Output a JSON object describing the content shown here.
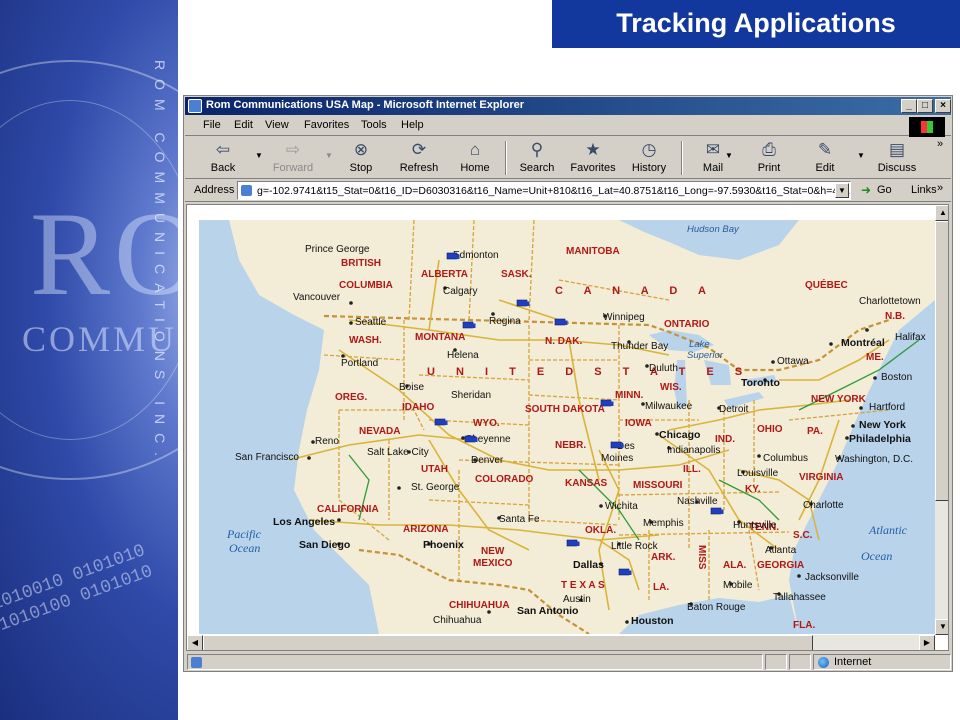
{
  "slide": {
    "title": "Tracking Applications",
    "watermark_big": "RO",
    "watermark_small": "COMMU",
    "vertical_text": "ROM COMMUNICATIONS INC.",
    "binary_text": "1010010 0101010 1010100 0101010"
  },
  "browser": {
    "window_title": "Rom Communications USA Map - Microsoft Internet Explorer",
    "window_buttons": [
      "_",
      "□",
      "×"
    ],
    "menu": [
      "File",
      "Edit",
      "View",
      "Favorites",
      "Tools",
      "Help"
    ],
    "toolbar": {
      "back": "Back",
      "forward": "Forward",
      "stop": "Stop",
      "refresh": "Refresh",
      "home": "Home",
      "search": "Search",
      "favorites": "Favorites",
      "history": "History",
      "mail": "Mail",
      "print": "Print",
      "edit": "Edit",
      "discuss": "Discuss",
      "more": "»"
    },
    "address": {
      "label": "Address",
      "value": "g=-102.9741&t15_Stat=0&t16_ID=D6030316&t16_Name=Unit+810&t16_Lat=40.8751&t16_Long=-97.5930&t16_Stat=0&h=4416",
      "go": "Go",
      "links": "Links",
      "links_more": "»"
    },
    "status": {
      "zone": "Internet"
    }
  },
  "map": {
    "colors": {
      "land": "#f3ecd6",
      "canada_land": "#efe8d2",
      "water": "#b9d3ea",
      "state_border": "#d6a23c",
      "highway": "#d9b43a",
      "vehicle": "#1f3fbf"
    },
    "country_labels": {
      "canada": "C A N A D A",
      "usa": "U N I T E D   S T A T E S"
    },
    "ocean_labels": {
      "pacific_1": "Pacific",
      "pacific_2": "Ocean",
      "atlantic_1": "Atlantic",
      "atlantic_2": "Ocean"
    },
    "water_labels": {
      "hudson": "Hudson Bay",
      "superior_1": "Lake",
      "superior_2": "Superior"
    },
    "region_labels": {
      "british_columbia_1": "BRITISH",
      "british_columbia_2": "COLUMBIA",
      "alberta": "ALBERTA",
      "sask": "SASK.",
      "manitoba": "MANITOBA",
      "ontario": "ONTARIO",
      "quebec": "QUÉBEC",
      "nb": "N.B.",
      "me": "ME.",
      "wash": "WASH.",
      "montana": "MONTANA",
      "ndak": "N. DAK.",
      "minn": "MINN.",
      "oreg": "OREG.",
      "idaho": "IDAHO",
      "wyo": "WYO.",
      "sdak": "SOUTH DAKOTA",
      "wis": "WIS.",
      "mich": "MICH",
      "newyork_state": "NEW YORK",
      "nevada": "NEVADA",
      "utah": "UTAH",
      "colorado": "COLORADO",
      "nebr": "NEBR.",
      "iowa": "IOWA",
      "ill": "ILL.",
      "ind": "IND.",
      "ohio": "OHIO",
      "pa": "PA.",
      "california": "CALIFORNIA",
      "kansas": "KANSAS",
      "missouri": "MISSOURI",
      "ky": "KY.",
      "virginia": "VIRGINIA",
      "arizona": "ARIZONA",
      "newmexico_1": "NEW",
      "newmexico_2": "MEXICO",
      "okla": "OKLA.",
      "ark": "ARK.",
      "tenn": "TENN.",
      "sc": "S.C.",
      "texas": "T E X A S",
      "la": "LA.",
      "miss": "MISS",
      "ala": "ALA.",
      "georgia": "GEORGIA",
      "fla": "FLA.",
      "chihuahua": "CHIHUAHUA"
    },
    "city_labels": {
      "prince_george": "Prince George",
      "edmonton": "Edmonton",
      "calgary": "Calgary",
      "vancouver": "Vancouver",
      "seattle": "Seattle",
      "regina": "Regina",
      "winnipeg": "Winnipeg",
      "thunder_bay": "Thunder Bay",
      "charlottetown": "Charlottetown",
      "halifax": "Halifax",
      "montreal": "Montréal",
      "ottawa": "Ottawa",
      "toronto": "Toronto",
      "boston": "Boston",
      "hartford": "Hartford",
      "new_york": "New York",
      "philadelphia": "Philadelphia",
      "washington": "Washington, D.C.",
      "portland": "Portland",
      "helena": "Helena",
      "duluth": "Duluth",
      "milwaukee": "Milwaukee",
      "detroit": "Detroit",
      "boise": "Boise",
      "sheridan": "Sheridan",
      "chicago": "Chicago",
      "reno": "Reno",
      "cheyenne": "Cheyenne",
      "des_moines_1": "Des",
      "des_moines_2": "Moines",
      "indianapolis": "Indianapolis",
      "columbus": "Columbus",
      "san_francisco": "San Francisco",
      "salt_lake": "Salt Lake City",
      "denver": "Denver",
      "louisville": "Louisville",
      "st_george": "St. George",
      "wichita": "Wichita",
      "nashville": "Nashville",
      "charlotte": "Charlotte",
      "los_angeles": "Los Angeles",
      "santa_fe": "Santa Fe",
      "memphis": "Memphis",
      "huntsville": "Huntsville",
      "san_diego": "San Diego",
      "phoenix": "Phoenix",
      "little_rock": "Little Rock",
      "atlanta": "Atlanta",
      "dallas": "Dallas",
      "jacksonville": "Jacksonville",
      "mobile": "Mobile",
      "tallahassee": "Tallahassee",
      "austin": "Austin",
      "baton_rouge": "Baton Rouge",
      "chihuahua_city": "Chihuahua",
      "san_antonio": "San Antonio",
      "houston": "Houston"
    }
  }
}
